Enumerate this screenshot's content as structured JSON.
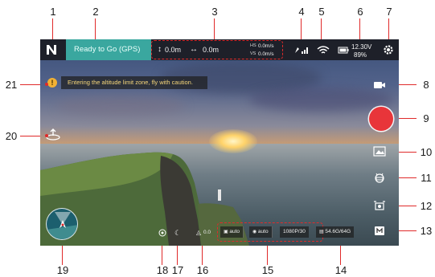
{
  "callouts": [
    "1",
    "2",
    "3",
    "4",
    "5",
    "6",
    "7",
    "8",
    "9",
    "10",
    "11",
    "12",
    "13",
    "14",
    "15",
    "16",
    "17",
    "18",
    "19",
    "20",
    "21"
  ],
  "topbar": {
    "status": "Ready to Go (GPS)",
    "altitude": "0.0m",
    "distance": "0.0m",
    "hs_label": "HS",
    "hs_value": "0.0m/s",
    "vs_label": "VS",
    "vs_value": "0.0m/s",
    "battery_voltage": "12.30V",
    "battery_percent": "89%"
  },
  "warning": {
    "text": "Entering the altitude limit zone, fly with caution."
  },
  "bottombar": {
    "ev_value": "0.0",
    "iso": "auto",
    "shutter": "auto",
    "resolution": "1080P/30",
    "storage": "54.6G/64G"
  },
  "icons": {
    "logo": "dji-logo-icon",
    "gps": "gps-signal-icon",
    "wifi": "wifi-signal-icon",
    "battery": "battery-icon",
    "settings": "gear-icon",
    "video_mode": "video-camera-icon",
    "playback": "playback-icon",
    "camera_settings": "camera-settings-icon",
    "gimbal": "gimbal-switch-icon",
    "media": "media-icon",
    "home": "return-home-icon",
    "night": "night-mode-icon",
    "flight_assist": "flight-assist-icon"
  },
  "colors": {
    "status_bg": "#3aa79f",
    "shutter": "#e8353a",
    "warning": "#f2b134",
    "callout_line": "#e02a2a"
  }
}
